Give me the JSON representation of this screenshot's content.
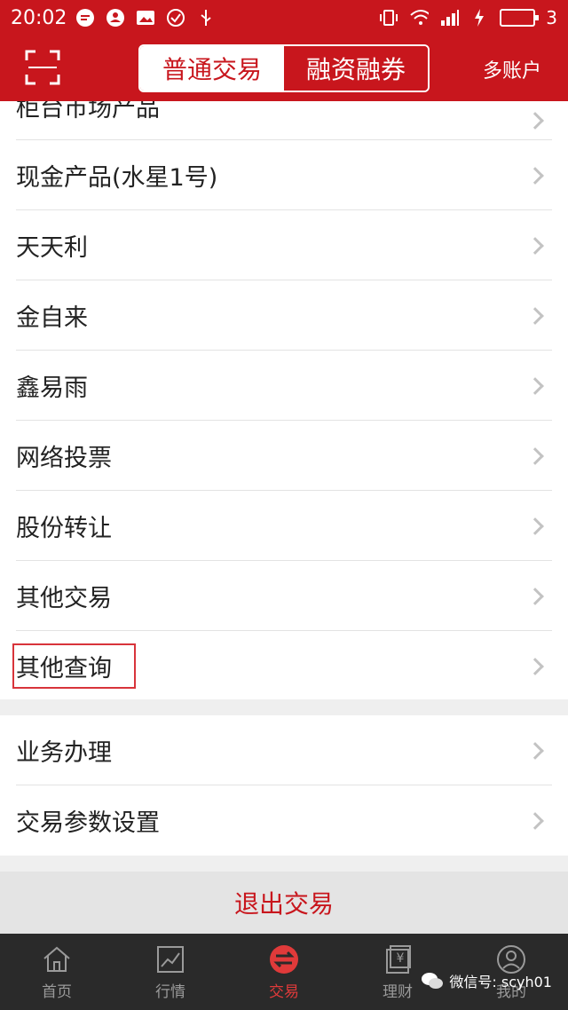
{
  "statusbar": {
    "time": "20:02",
    "battery_level": "3"
  },
  "header": {
    "segments": [
      {
        "label": "普通交易",
        "active": true
      },
      {
        "label": "融资融券",
        "active": false
      }
    ],
    "multi_account": "多账户"
  },
  "list_a": [
    {
      "label": "柜台市场产品"
    },
    {
      "label": "现金产品(水星1号)"
    },
    {
      "label": "天天利"
    },
    {
      "label": "金自来"
    },
    {
      "label": "鑫易雨"
    },
    {
      "label": "网络投票"
    },
    {
      "label": "股份转让"
    },
    {
      "label": "其他交易"
    },
    {
      "label": "其他查询"
    }
  ],
  "list_b": [
    {
      "label": "业务办理"
    },
    {
      "label": "交易参数设置"
    }
  ],
  "logout": "退出交易",
  "tabs": [
    {
      "label": "首页",
      "icon": "home-icon"
    },
    {
      "label": "行情",
      "icon": "chart-icon"
    },
    {
      "label": "交易",
      "icon": "trade-icon",
      "active": true
    },
    {
      "label": "理财",
      "icon": "finance-icon"
    },
    {
      "label": "我的",
      "icon": "profile-icon"
    }
  ],
  "watermark": "微信号: scyh01",
  "colors": {
    "brand": "#c8161d",
    "tab_active": "#e03a3a"
  }
}
